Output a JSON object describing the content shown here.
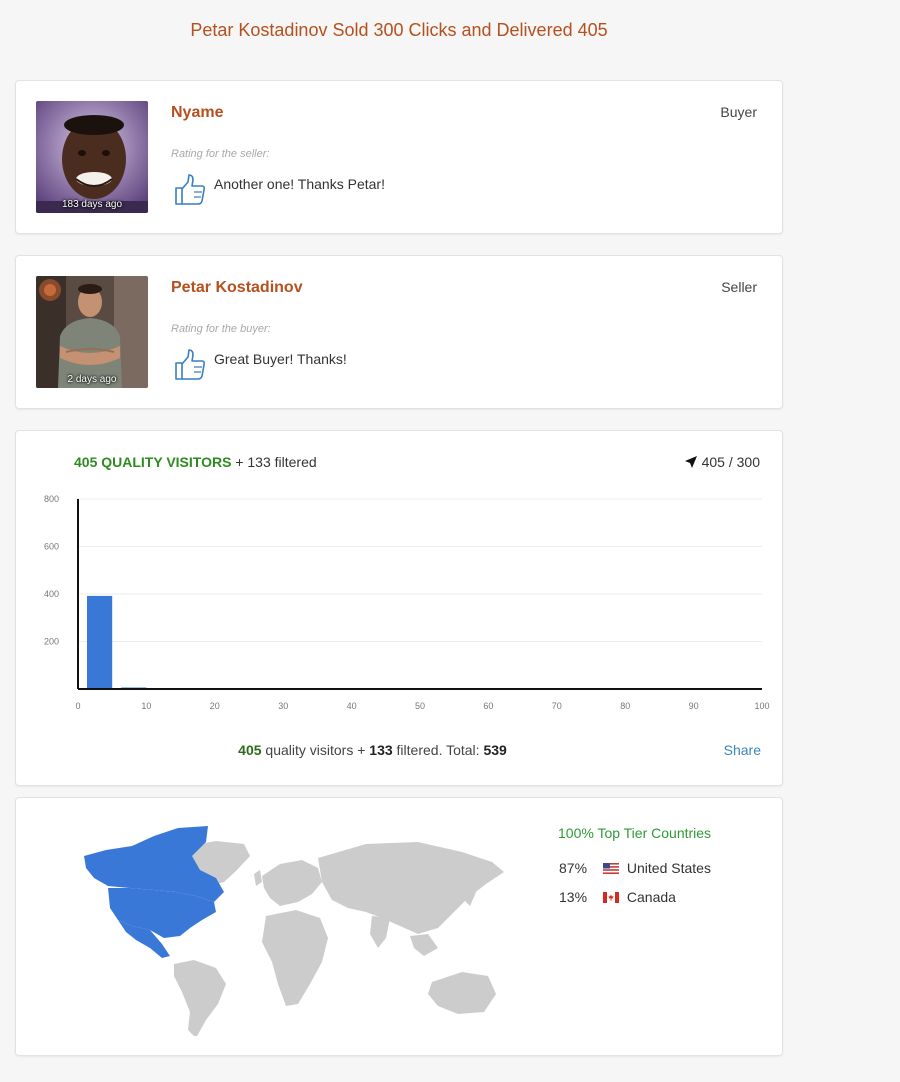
{
  "page": {
    "title": "Petar Kostadinov Sold 300 Clicks and Delivered 405"
  },
  "reviews": [
    {
      "name": "Nyame",
      "role": "Buyer",
      "rating_label": "Rating for the seller:",
      "comment": "Another one! Thanks Petar!",
      "age": "183 days ago",
      "icon": "thumbs-up-icon"
    },
    {
      "name": "Petar Kostadinov",
      "role": "Seller",
      "rating_label": "Rating for the buyer:",
      "comment": "Great Buyer! Thanks!",
      "age": "2 days ago",
      "icon": "thumbs-up-icon"
    }
  ],
  "stats": {
    "quality_visitors_header": "405 QUALITY VISITORS",
    "filtered_header": "+ 133 filtered",
    "progress": "405 / 300",
    "progress_icon": "location-arrow-icon",
    "footer": {
      "quality": "405",
      "quality_text": "quality visitors +",
      "filtered": "133",
      "filtered_text": "filtered. Total:",
      "total": "539"
    },
    "share_label": "Share"
  },
  "chart_data": {
    "type": "bar",
    "x": [
      2.5,
      7.5
    ],
    "values": [
      392,
      8
    ],
    "xlim": [
      0,
      100
    ],
    "ylim": [
      0,
      800
    ],
    "xticks": [
      0,
      10,
      20,
      30,
      40,
      50,
      60,
      70,
      80,
      90,
      100
    ],
    "yticks": [
      200,
      400,
      600,
      800
    ],
    "grid": true,
    "bar_color": "#3a78d8"
  },
  "geo": {
    "tier_label": "100% Top Tier Countries",
    "highlight_color": "#3a78d8",
    "base_color": "#cccccc",
    "countries": [
      {
        "pct": "87%",
        "name": "United States",
        "flag_icon": "us-flag-icon"
      },
      {
        "pct": "13%",
        "name": "Canada",
        "flag_icon": "canada-flag-icon"
      }
    ]
  }
}
